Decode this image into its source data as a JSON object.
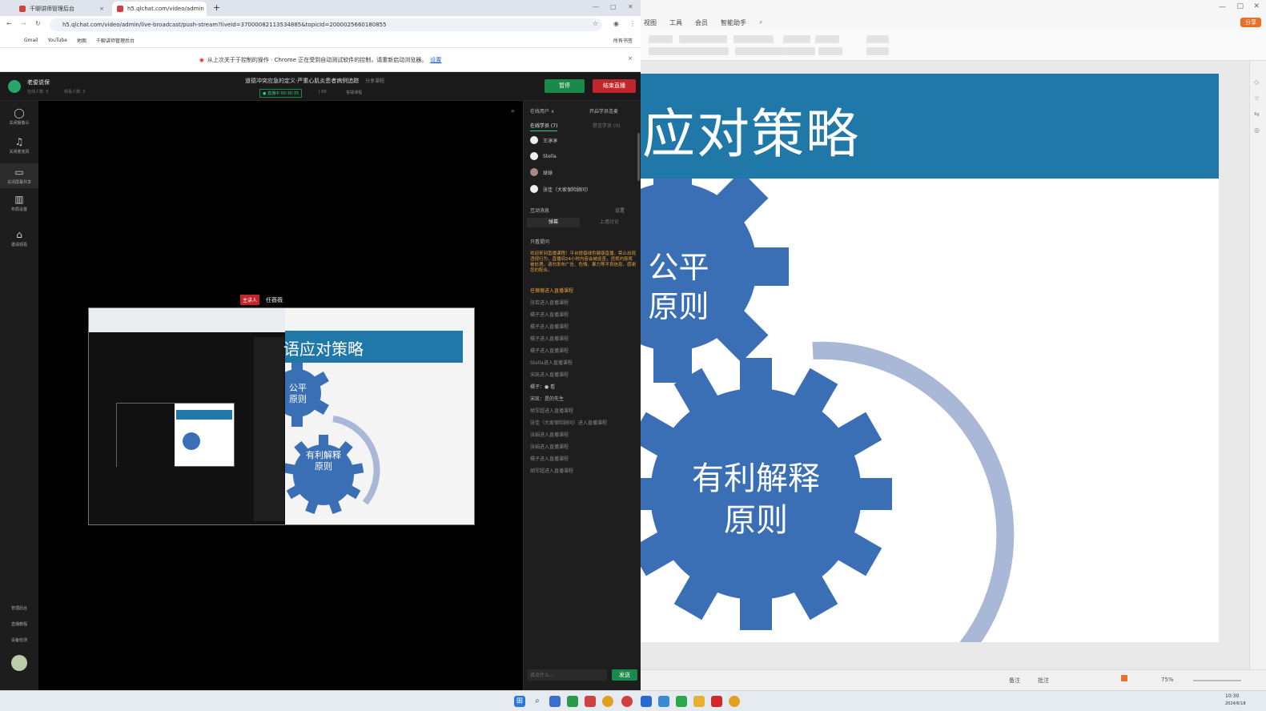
{
  "browser": {
    "tabs": [
      {
        "label": "千聊讲师管理后台",
        "active": false
      },
      {
        "label": "h5.qlchat.com/video/admin",
        "active": true
      }
    ],
    "new_tab": "+",
    "url": "h5.qlchat.com/video/admin/live-broadcast/push-stream?liveId=37000082113534885&topicId=2000025660180855",
    "bookmarks": [
      "Gmail",
      "YouTube",
      "地图",
      "千聊讲师管理后台"
    ],
    "all_bookmarks": "所有书签",
    "infobar_text": "从上次关于于控制的操作 · Chrome 正在受到自动测试软件的控制，请重新启动浏览器。",
    "infobar_link": "设置",
    "close_symbol": "×"
  },
  "console": {
    "account_name": "老俊说保",
    "account_sub": "在线人数: 5",
    "account_sub2": "观看人数: 3",
    "course_title": "道德冲突应急的定义·严重心肌炎患者病例追踪",
    "share_link": "分享课程",
    "live_status": "● 直播中 00:30:35",
    "stat_a": "| 00",
    "stat_b": "答疑课程",
    "pause_button": "暂停",
    "end_button": "结束直播",
    "rail_items": [
      "关闭摄像头",
      "关闭麦克风",
      "关闭屏幕共享",
      "布局设置",
      "邀请观看"
    ],
    "rail_bottom": [
      "管理后台",
      "直播教程",
      "设备检测"
    ],
    "presenter_badge": "主讲人",
    "presenter_name": "任薇薇"
  },
  "chat": {
    "viewer_header": "在线用户 ∧",
    "mic_header": "开启学员连麦",
    "tab_online": "在线学员 (7)",
    "tab_blocked": "禁言学员 (0)",
    "viewers": [
      "王淳淳",
      "Stella",
      "球球",
      "张佳（大家保险顾问）"
    ],
    "interact_title": "互动消息",
    "interact_settings": "设置",
    "tab_barrage": "弹幕",
    "tab_discussion": "上墙讨论",
    "only_questions": "只看提问",
    "notice": "欢迎来到直播课程！平台提倡绿色健康直播，禁止出现违规行为，直播间24小时内容会被巡查，违规内容将被处理。请勿发布广告、色情、暴力等不良信息，感谢您的配合。",
    "messages": [
      "任薇薇进入直播课程",
      "张若进入直播课程",
      "橘子进入直播课程",
      "橘子进入直播课程",
      "橘子进入直播课程",
      "橘子进入直播课程",
      "Stella进入直播课程",
      "宋凯进入直播课程",
      "橘子：● 看",
      "宋凯：是的先生",
      "胡军超进入直播课程",
      "张佳（大家保险顾问）进入直播课程",
      "张娟进入直播课程",
      "张娟进入直播课程",
      "橘子进入直播课程",
      "胡军超进入直播课程"
    ],
    "input_placeholder": "说点什么...",
    "send_button": "发送"
  },
  "share_preview": {
    "title": "语应对策略",
    "gear1": "公平\n原则",
    "gear2": "有利解释\n原则"
  },
  "presentation": {
    "menu": [
      "视图",
      "工具",
      "会员",
      "智能助手"
    ],
    "share_button": "分享",
    "slide_title": "语应对策略",
    "gear1_label": "公平\n原则",
    "gear2_label": "有利解释\n原则",
    "zoom": "75%",
    "notes_label": "备注",
    "annot_label": "批注"
  },
  "colors": {
    "slide_band": "#2078a8",
    "gear_blue": "#3a6fb6",
    "arrow_gray": "#a9b8d6",
    "live_green": "#1a8a4a",
    "end_red": "#c0262b"
  },
  "taskbar": {
    "icons": [
      "windows-start-icon",
      "search-icon",
      "file-explorer-icon",
      "app-icon",
      "app-icon",
      "chrome-icon",
      "app-icon",
      "app-icon",
      "wechat-icon",
      "folder-icon",
      "app-icon",
      "chrome-icon"
    ],
    "time": "10:30",
    "date": "2024/6/18"
  }
}
